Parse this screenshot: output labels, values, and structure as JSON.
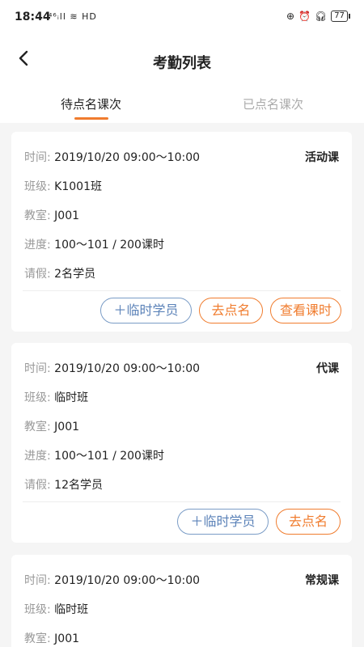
{
  "status": {
    "time": "18:44",
    "network": "⁴⁶ᵢll ≋ HD",
    "battery": "77"
  },
  "nav": {
    "title": "考勤列表"
  },
  "tabs": [
    "待点名课次",
    "已点名课次"
  ],
  "labels": {
    "time": "时间:",
    "class": "班级:",
    "room": "教室:",
    "progress": "进度:",
    "leave": "请假:"
  },
  "cards": [
    {
      "time": "2019/10/20 09:00～10:00",
      "type": "活动课",
      "class": "K1001班",
      "room": "J001",
      "progress": "100～101 / 200课时",
      "leave": "2名学员",
      "buttons": [
        "＋临时学员",
        "去点名",
        "查看课时"
      ]
    },
    {
      "time": "2019/10/20 09:00～10:00",
      "type": "代课",
      "class": "临时班",
      "room": "J001",
      "progress": "100～101 / 200课时",
      "leave": "12名学员",
      "buttons": [
        "＋临时学员",
        "去点名"
      ]
    },
    {
      "time": "2019/10/20 09:00～10:00",
      "type": "常规课",
      "class": "临时班",
      "room": "J001"
    }
  ]
}
